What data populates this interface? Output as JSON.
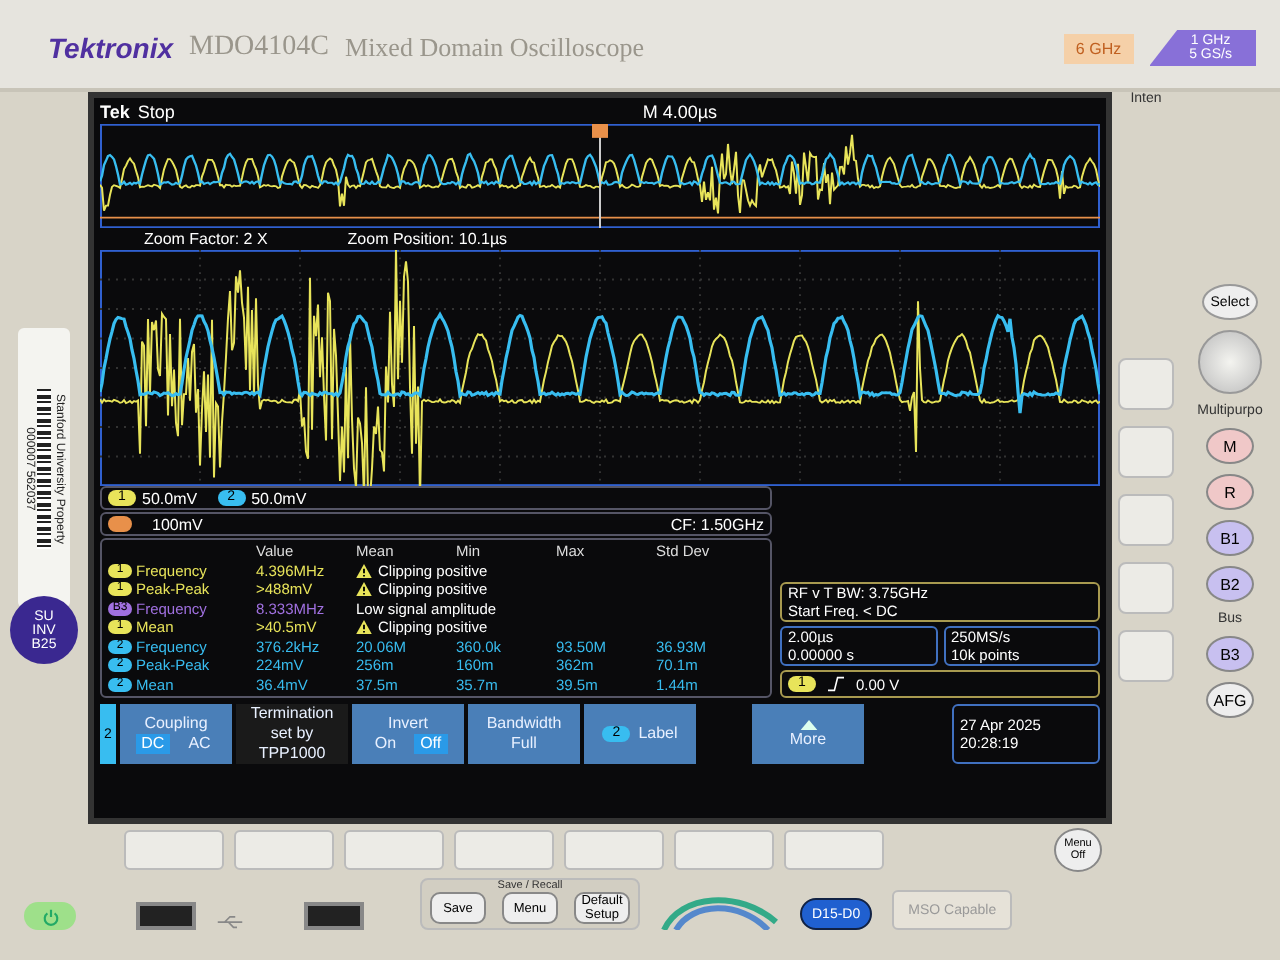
{
  "bezel": {
    "brand": "Tektronix",
    "model": "MDO4104C",
    "model_desc": "Mixed Domain Oscilloscope",
    "badge_spectrum": "6 GHz",
    "badge_bandwidth": [
      "1 GHz",
      "5 GS/s"
    ]
  },
  "sticker": {
    "owner": "Stanford University Property",
    "number": "000007 562037",
    "tag": [
      "SU",
      "INV",
      "B25"
    ]
  },
  "screen": {
    "status": {
      "logo": "Tek",
      "state": "Stop",
      "timebase": "M 4.00µs"
    },
    "zoom": {
      "factor": "Zoom Factor: 2 X",
      "position": "Zoom Position: 10.1µs"
    },
    "scales": [
      {
        "channel": "1",
        "color": "#e8e45a",
        "value": "50.0mV"
      },
      {
        "channel": "2",
        "color": "#38bdf0",
        "value": "50.0mV"
      }
    ],
    "ref": {
      "value": "100mV",
      "cf": "CF: 1.50GHz"
    },
    "measurements": {
      "columns": [
        "Value",
        "Mean",
        "Min",
        "Max",
        "Std Dev"
      ],
      "rows": [
        {
          "kind": "warning",
          "channel": "1",
          "color": "#e8e45a",
          "name": "Frequency",
          "value": "4.396MHz",
          "note": "Clipping positive"
        },
        {
          "kind": "warning",
          "channel": "1",
          "color": "#e8e45a",
          "name": "Peak-Peak",
          "value": ">488mV",
          "note": "Clipping positive"
        },
        {
          "kind": "note",
          "channel": "B3",
          "color": "#a070e0",
          "name": "Frequency",
          "value": "8.333MHz",
          "note": "Low signal amplitude"
        },
        {
          "kind": "warning",
          "channel": "1",
          "color": "#e8e45a",
          "name": "Mean",
          "value": ">40.5mV",
          "note": "Clipping positive"
        },
        {
          "kind": "stats",
          "channel": "2",
          "color": "#38bdf0",
          "name": "Frequency",
          "value": "376.2kHz",
          "stats": [
            "20.06M",
            "360.0k",
            "93.50M",
            "36.93M"
          ]
        },
        {
          "kind": "stats",
          "channel": "2",
          "color": "#38bdf0",
          "name": "Peak-Peak",
          "value": "224mV",
          "stats": [
            "256m",
            "160m",
            "362m",
            "70.1m"
          ]
        },
        {
          "kind": "stats",
          "channel": "2",
          "color": "#38bdf0",
          "name": "Mean",
          "value": "36.4mV",
          "stats": [
            "37.5m",
            "35.7m",
            "39.5m",
            "1.44m"
          ]
        }
      ]
    },
    "horizontal": {
      "scale": "2.00µs",
      "position": "0.00000 s"
    },
    "acquisition": {
      "rate": "250MS/s",
      "points": "10k points"
    },
    "rf": {
      "bw": "RF v T BW: 3.75GHz",
      "start": "Start Freq. < DC"
    },
    "trigger": {
      "channel": "1",
      "level": "0.00 V"
    },
    "datetime": {
      "date": "27 Apr 2025",
      "time": "20:28:19"
    },
    "menu": {
      "channel": "2",
      "items": [
        {
          "kind": "toggle",
          "title": "Coupling",
          "options": [
            {
              "label": "DC",
              "selected": true
            },
            {
              "label": "AC",
              "selected": false
            }
          ]
        },
        {
          "kind": "text",
          "title": "Termination",
          "lines": [
            "set by",
            "TPP1000"
          ]
        },
        {
          "kind": "toggle",
          "title": "Invert",
          "options": [
            {
              "label": "On",
              "selected": false
            },
            {
              "label": "Off",
              "selected": true
            }
          ]
        },
        {
          "kind": "button",
          "title": "Bandwidth",
          "lines": [
            "Full"
          ]
        },
        {
          "kind": "badge",
          "channel": "2",
          "title": "Label"
        },
        {
          "kind": "more",
          "title": "More"
        }
      ]
    }
  },
  "side_panel": {
    "intensity": "Inten",
    "select": "Select",
    "multipurpose": "Multipurpo",
    "buttons": [
      "M",
      "R",
      "B1",
      "B2"
    ],
    "bus": "Bus",
    "bus_buttons": [
      "B3"
    ],
    "afg": "AFG"
  },
  "front_panel": {
    "menu_off": [
      "Menu",
      "Off"
    ],
    "save_recall": "Save / Recall",
    "buttons": [
      "Save",
      "Menu",
      "Default Setup"
    ],
    "digital": "D15-D0",
    "mso": "MSO Capable"
  }
}
